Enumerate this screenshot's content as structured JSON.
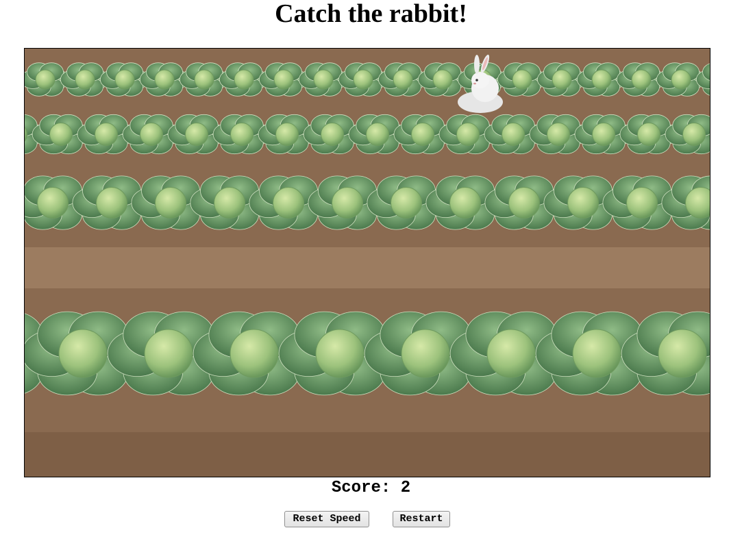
{
  "title": "Catch the rabbit!",
  "score": {
    "label": "Score:",
    "value": "2"
  },
  "buttons": {
    "reset_speed": "Reset Speed",
    "restart": "Restart"
  },
  "colors": {
    "soil": "#8a6a50",
    "cabbage_dark": "#4f7d4a",
    "cabbage_light": "#a7c98a",
    "rabbit": "#eeeeee"
  },
  "icons": {
    "rabbit": "rabbit-sprite"
  }
}
